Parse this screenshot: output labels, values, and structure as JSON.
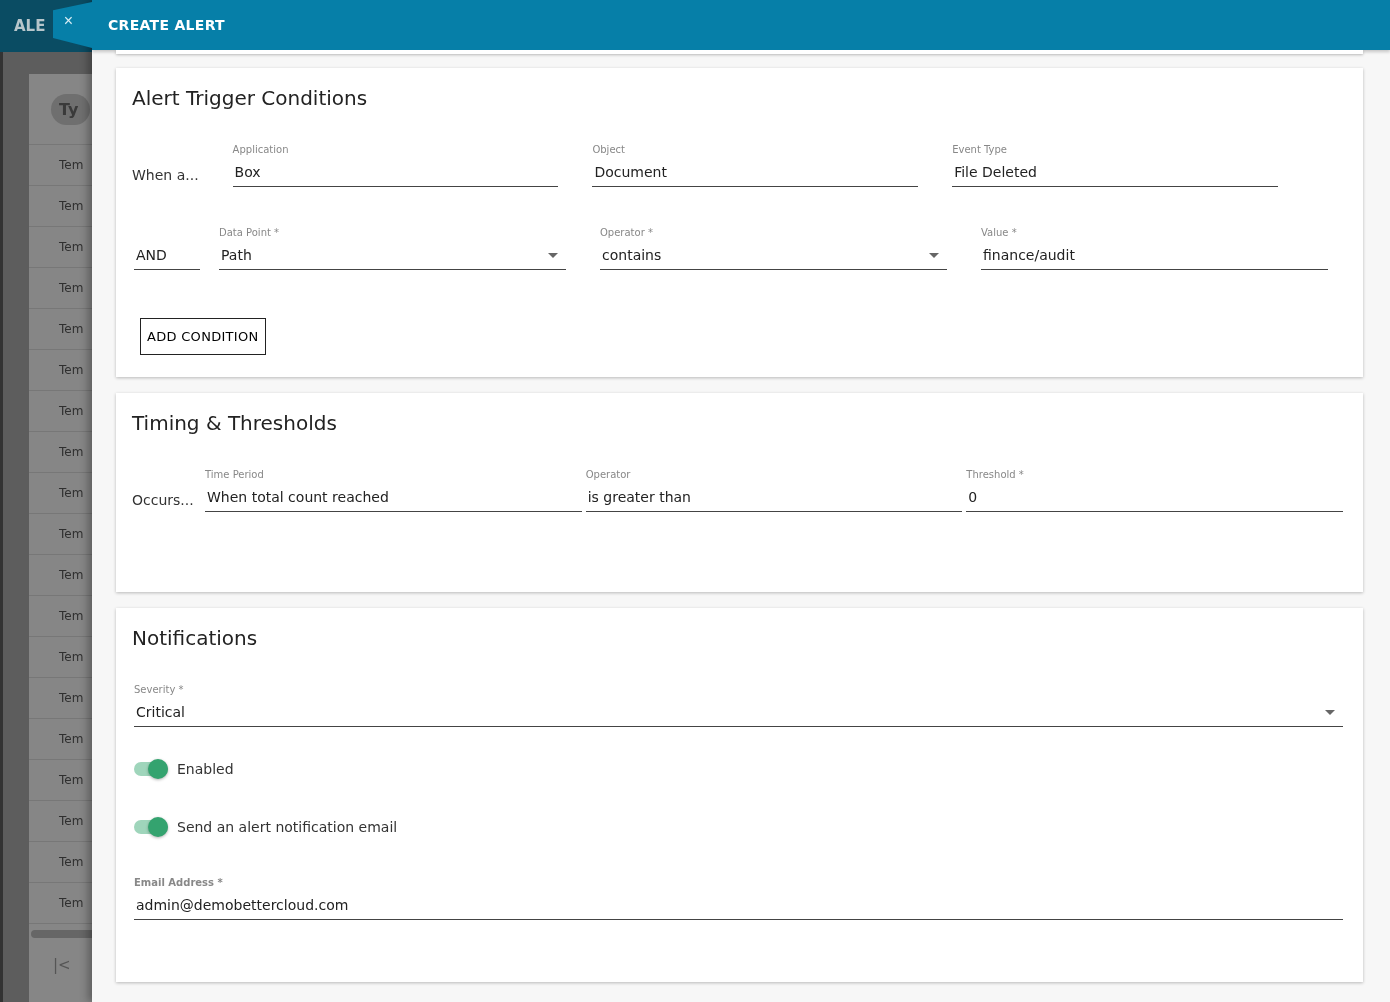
{
  "header": {
    "background_title": "ALE",
    "close": "×",
    "title": "CREATE ALERT"
  },
  "background_list": {
    "chip": "Ty",
    "rows": [
      "Tem",
      "Tem",
      "Tem",
      "Tem",
      "Tem",
      "Tem",
      "Tem",
      "Tem",
      "Tem",
      "Tem",
      "Tem",
      "Tem",
      "Tem",
      "Tem",
      "Tem",
      "Tem",
      "Tem",
      "Tem",
      "Tem"
    ],
    "pager": "|<"
  },
  "sections": [
    {
      "title": "Alert Trigger Conditions",
      "rows": [
        {
          "lead": "When a...",
          "kind": "text",
          "fields": [
            {
              "label": "Application",
              "value": "Box",
              "kind": "text"
            },
            {
              "label": "Object",
              "value": "Document",
              "kind": "text"
            },
            {
              "label": "Event Type",
              "value": "File Deleted",
              "kind": "text"
            }
          ]
        },
        {
          "lead": "AND",
          "kind": "field",
          "fields": [
            {
              "label": "Data Point *",
              "value": "Path",
              "kind": "dropdown"
            },
            {
              "label": "Operator *",
              "value": "contains",
              "kind": "dropdown"
            },
            {
              "label": "Value *",
              "value": "finance/audit",
              "kind": "text"
            }
          ]
        }
      ],
      "button": "ADD CONDITION"
    },
    {
      "title": "Timing & Thresholds",
      "rows": [
        {
          "lead": "Occurs...",
          "kind": "text",
          "fields": [
            {
              "label": "Time Period",
              "value": "When total count reached",
              "kind": "text"
            },
            {
              "label": "Operator",
              "value": "is greater than",
              "kind": "text"
            },
            {
              "label": "Threshold *",
              "value": "0",
              "kind": "text"
            }
          ]
        }
      ]
    },
    {
      "title": "Notifications",
      "severity": {
        "label": "Severity *",
        "value": "Critical",
        "kind": "dropdown"
      },
      "toggles": [
        {
          "label": "Enabled",
          "on": true
        },
        {
          "label": "Send an alert notification email",
          "on": true
        }
      ],
      "email": {
        "label": "Email Address *",
        "value": "admin@demobettercloud.com"
      }
    }
  ]
}
